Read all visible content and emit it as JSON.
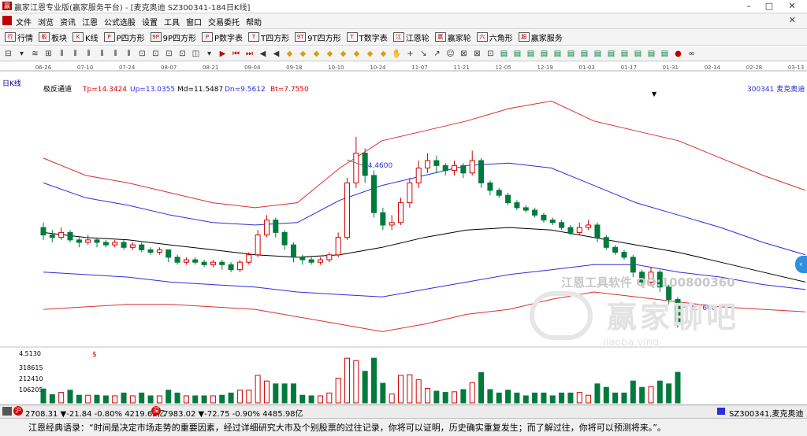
{
  "window": {
    "title": "赢家江恩专业版(赢家服务平台) - [麦克奥迪 SZ300341-184日K线]",
    "minimize": "–",
    "maximize": "□",
    "close": "✕"
  },
  "menu": {
    "items": [
      "文件",
      "浏览",
      "资讯",
      "江恩",
      "公式选股",
      "设置",
      "工具",
      "窗口",
      "交易委托",
      "帮助"
    ],
    "close_label": "✕"
  },
  "toolbar1": {
    "items": [
      {
        "icon": "行",
        "label": "行情"
      },
      {
        "icon": "板",
        "label": "板块"
      },
      {
        "icon": "K",
        "label": "K线"
      },
      {
        "icon": "P",
        "label": "P四方形"
      },
      {
        "icon": "9P",
        "label": "9P四方形"
      },
      {
        "icon": "P",
        "label": "P数字表"
      },
      {
        "icon": "T",
        "label": "T四方形"
      },
      {
        "icon": "9T",
        "label": "9T四方形"
      },
      {
        "icon": "T",
        "label": "T数字表"
      },
      {
        "icon": "江",
        "label": "江恩轮"
      },
      {
        "icon": "赢",
        "label": "赢家轮"
      },
      {
        "icon": "六",
        "label": "六角形"
      },
      {
        "icon": "服",
        "label": "赢家服务"
      }
    ]
  },
  "toolbar2": {
    "icons": [
      "⊟",
      "▾",
      "≋",
      "⊞",
      "⫴",
      "⫴",
      "⫴",
      "⫴",
      "⫴",
      "⫴",
      "⊡",
      "⊡",
      "⊡",
      "⊡",
      "◫",
      "▾",
      "▶",
      "⏮",
      "⏭",
      "◀",
      "◀",
      "◆",
      "◆",
      "◆",
      "◆",
      "◆",
      "◆",
      "◆",
      "◆",
      "✋",
      "+",
      "↘",
      "↗",
      "☺",
      "⊠",
      "⊠",
      "⊡",
      "▤",
      "▤",
      "▤",
      "▤",
      "▤",
      "▤",
      "▤",
      "▤",
      "▤",
      "▤",
      "▤",
      "▤",
      "▤",
      "●",
      "∞"
    ]
  },
  "chart": {
    "period_label": "日K线",
    "indicator_name": "极反通道",
    "tp_label": "Tp=14.3424",
    "up_label": "Up=13.0355",
    "md_label": "Md=11.5487",
    "dn_label": "Dn=9.5612",
    "bt_label": "Bt=7.7550",
    "stock_label": "300341 麦克奥迪",
    "high_label": "14.4600",
    "low_label": "6.7600",
    "marker": "$",
    "date_ticks": [
      "06-26",
      "07-10",
      "07-24",
      "08-07",
      "08-21",
      "09-04",
      "09-18",
      "10-10",
      "10-24",
      "11-07",
      "11-21",
      "12-05",
      "12-19",
      "01-03",
      "01-17",
      "01-31",
      "02-14",
      "02-28",
      "03-13"
    ],
    "volume_ticks": [
      "4.5130",
      "318615",
      "212410",
      "106205"
    ],
    "colors": {
      "up": "#d40000",
      "down": "#007a3d",
      "channel_outer": "#d93030",
      "channel_inner": "#2c2ce0",
      "middle": "#000000"
    }
  },
  "chart_data": {
    "type": "candlestick",
    "dates": [
      "06-26",
      "07-10",
      "07-24",
      "08-07",
      "08-21",
      "09-04",
      "09-18",
      "10-10",
      "10-24",
      "11-07",
      "11-21",
      "12-05",
      "12-19",
      "01-03",
      "01-17",
      "01-31",
      "02-14",
      "02-28",
      "03-13"
    ],
    "series": [
      {
        "name": "Tp",
        "values": [
          13.6,
          12.9,
          12.6,
          12.2,
          11.8,
          11.6,
          11.8,
          13.2,
          14.3,
          14.7,
          15.1,
          15.6,
          15.9,
          15.1,
          14.7,
          14.3,
          13.6,
          12.9,
          12.3
        ]
      },
      {
        "name": "Up",
        "values": [
          12.6,
          12.0,
          11.7,
          11.3,
          11.0,
          10.9,
          11.0,
          11.9,
          12.5,
          12.9,
          13.3,
          13.4,
          13.2,
          12.5,
          11.8,
          11.3,
          10.8,
          10.2,
          9.7
        ]
      },
      {
        "name": "Md",
        "values": [
          10.6,
          10.4,
          10.3,
          10.1,
          9.9,
          9.7,
          9.6,
          9.7,
          10.0,
          10.4,
          10.7,
          10.8,
          10.7,
          10.4,
          10.1,
          9.8,
          9.4,
          9.0,
          8.6
        ]
      },
      {
        "name": "Dn",
        "values": [
          9.0,
          8.9,
          8.8,
          8.6,
          8.5,
          8.4,
          8.2,
          8.1,
          8.0,
          8.3,
          8.6,
          8.9,
          9.1,
          9.3,
          9.3,
          9.0,
          8.8,
          8.5,
          8.3
        ]
      },
      {
        "name": "Bt",
        "values": [
          7.5,
          7.6,
          7.7,
          7.7,
          7.6,
          7.5,
          7.2,
          6.9,
          6.6,
          6.9,
          7.3,
          7.5,
          7.9,
          8.2,
          8.0,
          7.8,
          7.6,
          7.5,
          7.4
        ]
      }
    ],
    "candles": [
      {
        "o": 10.8,
        "c": 10.5,
        "h": 11.0,
        "l": 10.3
      },
      {
        "o": 10.5,
        "c": 10.4,
        "h": 10.7,
        "l": 10.2
      },
      {
        "o": 10.4,
        "c": 10.6,
        "h": 10.8,
        "l": 10.3
      },
      {
        "o": 10.6,
        "c": 10.3,
        "h": 10.7,
        "l": 10.2
      },
      {
        "o": 10.3,
        "c": 10.2,
        "h": 10.4,
        "l": 10.0
      },
      {
        "o": 10.2,
        "c": 10.3,
        "h": 10.5,
        "l": 10.1
      },
      {
        "o": 10.3,
        "c": 10.2,
        "h": 10.4,
        "l": 10.0
      },
      {
        "o": 10.2,
        "c": 10.1,
        "h": 10.3,
        "l": 10.0
      },
      {
        "o": 10.1,
        "c": 10.2,
        "h": 10.3,
        "l": 10.0
      },
      {
        "o": 10.2,
        "c": 10.0,
        "h": 10.3,
        "l": 9.9
      },
      {
        "o": 10.0,
        "c": 10.1,
        "h": 10.2,
        "l": 9.9
      },
      {
        "o": 10.1,
        "c": 9.9,
        "h": 10.2,
        "l": 9.8
      },
      {
        "o": 9.9,
        "c": 9.8,
        "h": 10.0,
        "l": 9.7
      },
      {
        "o": 9.8,
        "c": 9.9,
        "h": 10.0,
        "l": 9.7
      },
      {
        "o": 9.9,
        "c": 9.6,
        "h": 9.9,
        "l": 9.4
      },
      {
        "o": 9.6,
        "c": 9.4,
        "h": 9.7,
        "l": 9.3
      },
      {
        "o": 9.4,
        "c": 9.5,
        "h": 9.6,
        "l": 9.3
      },
      {
        "o": 9.5,
        "c": 9.4,
        "h": 9.6,
        "l": 9.3
      },
      {
        "o": 9.4,
        "c": 9.3,
        "h": 9.5,
        "l": 9.2
      },
      {
        "o": 9.3,
        "c": 9.4,
        "h": 9.5,
        "l": 9.2
      },
      {
        "o": 9.4,
        "c": 9.3,
        "h": 9.5,
        "l": 9.1
      },
      {
        "o": 9.3,
        "c": 9.1,
        "h": 9.4,
        "l": 9.0
      },
      {
        "o": 9.1,
        "c": 9.4,
        "h": 9.5,
        "l": 9.0
      },
      {
        "o": 9.4,
        "c": 9.7,
        "h": 9.8,
        "l": 9.3
      },
      {
        "o": 9.7,
        "c": 10.5,
        "h": 10.7,
        "l": 9.6
      },
      {
        "o": 10.5,
        "c": 11.1,
        "h": 11.3,
        "l": 10.4
      },
      {
        "o": 11.1,
        "c": 10.6,
        "h": 11.2,
        "l": 10.4
      },
      {
        "o": 10.6,
        "c": 10.1,
        "h": 10.7,
        "l": 9.9
      },
      {
        "o": 10.1,
        "c": 9.6,
        "h": 10.2,
        "l": 9.4
      },
      {
        "o": 9.6,
        "c": 9.5,
        "h": 9.7,
        "l": 9.3
      },
      {
        "o": 9.5,
        "c": 9.4,
        "h": 9.6,
        "l": 9.3
      },
      {
        "o": 9.4,
        "c": 9.5,
        "h": 9.6,
        "l": 9.3
      },
      {
        "o": 9.5,
        "c": 9.7,
        "h": 9.8,
        "l": 9.4
      },
      {
        "o": 9.7,
        "c": 10.4,
        "h": 10.6,
        "l": 9.6
      },
      {
        "o": 10.4,
        "c": 12.6,
        "h": 12.8,
        "l": 10.3
      },
      {
        "o": 12.6,
        "c": 13.8,
        "h": 14.46,
        "l": 12.4
      },
      {
        "o": 13.8,
        "c": 12.9,
        "h": 14.0,
        "l": 12.6
      },
      {
        "o": 12.9,
        "c": 11.4,
        "h": 13.1,
        "l": 11.2
      },
      {
        "o": 11.4,
        "c": 10.9,
        "h": 11.6,
        "l": 10.7
      },
      {
        "o": 10.9,
        "c": 11.0,
        "h": 11.3,
        "l": 10.7
      },
      {
        "o": 11.0,
        "c": 11.8,
        "h": 12.0,
        "l": 10.9
      },
      {
        "o": 11.8,
        "c": 12.6,
        "h": 12.8,
        "l": 11.6
      },
      {
        "o": 12.6,
        "c": 13.2,
        "h": 13.5,
        "l": 12.4
      },
      {
        "o": 13.2,
        "c": 13.5,
        "h": 13.8,
        "l": 13.0
      },
      {
        "o": 13.5,
        "c": 13.3,
        "h": 13.7,
        "l": 13.0
      },
      {
        "o": 13.3,
        "c": 13.1,
        "h": 13.4,
        "l": 12.9
      },
      {
        "o": 13.1,
        "c": 13.3,
        "h": 13.5,
        "l": 12.9
      },
      {
        "o": 13.3,
        "c": 13.0,
        "h": 13.4,
        "l": 12.8
      },
      {
        "o": 13.0,
        "c": 13.5,
        "h": 13.9,
        "l": 12.9
      },
      {
        "o": 13.5,
        "c": 12.6,
        "h": 13.6,
        "l": 12.4
      },
      {
        "o": 12.6,
        "c": 12.3,
        "h": 12.7,
        "l": 12.1
      },
      {
        "o": 12.3,
        "c": 12.1,
        "h": 12.4,
        "l": 12.0
      },
      {
        "o": 12.1,
        "c": 11.8,
        "h": 12.2,
        "l": 11.7
      },
      {
        "o": 11.8,
        "c": 11.6,
        "h": 11.9,
        "l": 11.5
      },
      {
        "o": 11.6,
        "c": 11.5,
        "h": 11.7,
        "l": 11.4
      },
      {
        "o": 11.5,
        "c": 11.3,
        "h": 11.6,
        "l": 11.2
      },
      {
        "o": 11.3,
        "c": 11.1,
        "h": 11.4,
        "l": 11.0
      },
      {
        "o": 11.1,
        "c": 11.0,
        "h": 11.2,
        "l": 10.9
      },
      {
        "o": 11.0,
        "c": 10.8,
        "h": 11.1,
        "l": 10.7
      },
      {
        "o": 10.8,
        "c": 10.6,
        "h": 10.9,
        "l": 10.5
      },
      {
        "o": 10.6,
        "c": 10.8,
        "h": 11.0,
        "l": 10.5
      },
      {
        "o": 10.8,
        "c": 10.9,
        "h": 11.1,
        "l": 10.7
      },
      {
        "o": 10.9,
        "c": 10.4,
        "h": 11.0,
        "l": 10.2
      },
      {
        "o": 10.4,
        "c": 10.0,
        "h": 10.5,
        "l": 9.9
      },
      {
        "o": 10.0,
        "c": 9.8,
        "h": 10.1,
        "l": 9.7
      },
      {
        "o": 9.8,
        "c": 9.6,
        "h": 9.9,
        "l": 9.5
      },
      {
        "o": 9.6,
        "c": 9.0,
        "h": 9.7,
        "l": 8.8
      },
      {
        "o": 9.0,
        "c": 8.6,
        "h": 9.1,
        "l": 8.5
      },
      {
        "o": 8.6,
        "c": 9.0,
        "h": 9.2,
        "l": 8.5
      },
      {
        "o": 9.0,
        "c": 8.4,
        "h": 9.1,
        "l": 8.2
      },
      {
        "o": 8.4,
        "c": 7.9,
        "h": 8.5,
        "l": 7.7
      },
      {
        "o": 7.9,
        "c": 7.0,
        "h": 8.0,
        "l": 6.76
      }
    ],
    "volume_ylim": [
      0,
      450000
    ],
    "ylim": [
      6.2,
      16.2
    ]
  },
  "bottom": {
    "sh_icon": "沪",
    "sh_text": "2708.31 ▼-21.84 -0.80% 4219.62亿",
    "sz_icon": "深",
    "sz_text": "7983.02 ▼-72.75 -0.90% 4485.98亿",
    "right_text": "SZ300341,麦克奥迪"
  },
  "status": {
    "text": "江恩经典语录：“时间是决定市场走势的重要因素，经过详细研究大市及个别股票的过往记录，你将可以证明，历史确实重复发生；而了解过往，你将可以预测将来。”。"
  },
  "watermark": {
    "brand": "江恩工具软件  QQ:100800360",
    "forum": "赢家聊吧",
    "url": "jiaoba.ying"
  },
  "nav": {
    "scroll_label": "‹"
  }
}
